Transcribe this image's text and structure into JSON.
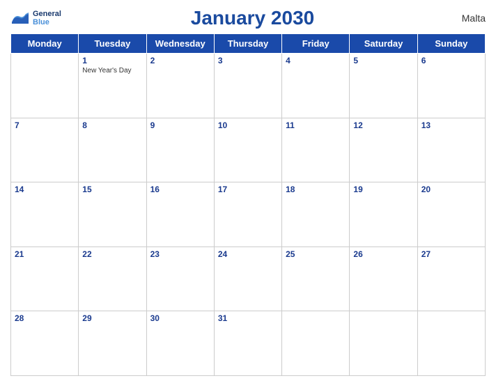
{
  "header": {
    "logo_general": "General",
    "logo_blue": "Blue",
    "title": "January 2030",
    "country": "Malta"
  },
  "days_of_week": [
    "Monday",
    "Tuesday",
    "Wednesday",
    "Thursday",
    "Friday",
    "Saturday",
    "Sunday"
  ],
  "weeks": [
    [
      {
        "num": "",
        "empty": true
      },
      {
        "num": "1",
        "holiday": "New Year's Day"
      },
      {
        "num": "2"
      },
      {
        "num": "3"
      },
      {
        "num": "4"
      },
      {
        "num": "5"
      },
      {
        "num": "6"
      }
    ],
    [
      {
        "num": "7"
      },
      {
        "num": "8"
      },
      {
        "num": "9"
      },
      {
        "num": "10"
      },
      {
        "num": "11"
      },
      {
        "num": "12"
      },
      {
        "num": "13"
      }
    ],
    [
      {
        "num": "14"
      },
      {
        "num": "15"
      },
      {
        "num": "16"
      },
      {
        "num": "17"
      },
      {
        "num": "18"
      },
      {
        "num": "19"
      },
      {
        "num": "20"
      }
    ],
    [
      {
        "num": "21"
      },
      {
        "num": "22"
      },
      {
        "num": "23"
      },
      {
        "num": "24"
      },
      {
        "num": "25"
      },
      {
        "num": "26"
      },
      {
        "num": "27"
      }
    ],
    [
      {
        "num": "28"
      },
      {
        "num": "29"
      },
      {
        "num": "30"
      },
      {
        "num": "31"
      },
      {
        "num": "",
        "empty": true
      },
      {
        "num": "",
        "empty": true
      },
      {
        "num": "",
        "empty": true
      }
    ]
  ]
}
